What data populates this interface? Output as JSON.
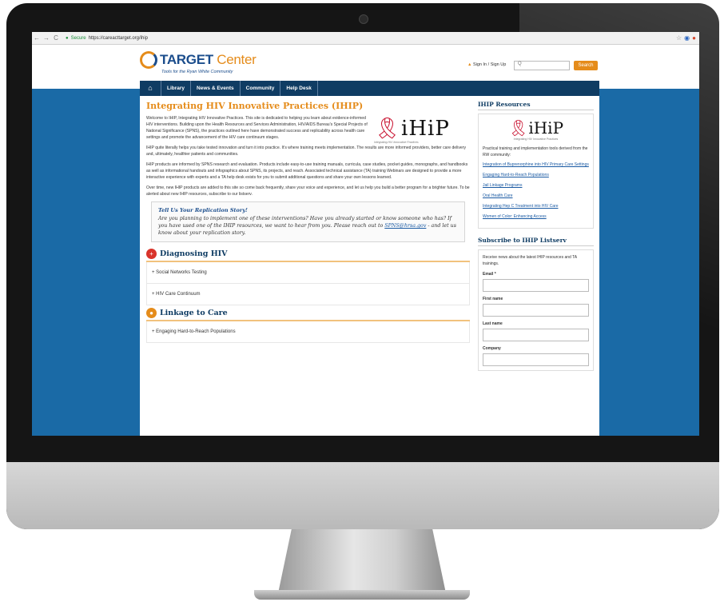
{
  "browser": {
    "secure_label": "Secure",
    "url": "https://careacttarget.org/ihip",
    "nav_icons": {
      "back": "back-arrow-icon",
      "forward": "forward-arrow-icon",
      "reload": "reload-icon"
    },
    "back": "←",
    "forward": "→",
    "reload": "C"
  },
  "header": {
    "logo_name": "TARGET",
    "logo_center": "Center",
    "tagline": "Tools for the Ryan White Community",
    "signin": "Sign In / Sign Up",
    "search_placeholder": "Q",
    "search_button": "Search"
  },
  "nav": {
    "items": [
      "Library",
      "News & Events",
      "Community",
      "Help Desk"
    ]
  },
  "main": {
    "title": "Integrating HIV Innovative Practices (IHIP)",
    "intro": "Welcome to IHIP, Integrating HIV Innovative Practices. This site is dedicated to helping you learn about evidence-informed HIV interventions. Building upon the Health Resources and Services Administration, HIV/AIDS Bureau's Special Projects of National Significance (SPNS), the practices outlined here have demonstrated success and replicability across health care settings and promote the advancement of the HIV care continuum stages.",
    "p2": "IHIP quite literally helps you take tested innovation and turn it into practice. It's where training meets implementation. The results are more informed providers, better care delivery and, ultimately, healthier patients and communities.",
    "p3": "IHIP products are informed by SPNS research and evaluation. Products include easy-to-use training manuals, curricula, case studies, pocket guides, monographs, and handbooks as well as informational handouts and infographics about SPNS, its projects, and reach. Associated technical assistance (TA) training Webinars are designed to provide a more interactive experience with experts and a TA help desk exists for you to submit additional questions and share your own lessons learned.",
    "p4": "Over time, new IHIP products are added to this site so come back frequently, share your voice and experience, and let us help you build a better program for a brighter future. To be alerted about new IHIP resources, subscribe to our listserv.",
    "logo_word": "iHiP",
    "logo_sub": "Integrating HIV Innovative Practices",
    "callout": {
      "title": "Tell Us Your Replication Story!",
      "body_before": "Are you planning to implement one of these interventions? Have you already started or know someone who has? If you have used one of the IHIP resources, we want to hear from you. Please reach out to ",
      "email": "SPNS@hrsa.gov",
      "body_after": " - and let us know about your replication story."
    },
    "sections": [
      {
        "title": "Diagnosing HIV",
        "icon": "+",
        "color": "#d9342b",
        "items": [
          "Social Networks Testing",
          "HIV Care Continuum"
        ]
      },
      {
        "title": "Linkage to Care",
        "icon": "●",
        "color": "#e58c1b",
        "items": [
          "Engaging Hard-to-Reach Populations"
        ]
      }
    ]
  },
  "sidebar": {
    "resources_title": "IHIP Resources",
    "logo_word": "iHiP",
    "logo_sub": "Integrating HIV Innovative Practices",
    "desc": "Practical training and implementation tools derived from the RW community:",
    "links": [
      "Integration of Buprenorphine into HIV Primary Care Settings",
      "Engaging Hard-to-Reach Populations",
      "Jail Linkage Programs",
      "Oral Health Care",
      "Integrating Hep C Treatment into HIV Care",
      "Women of Color: Enhancing Access"
    ],
    "subscribe_title": "Subscribe to IHIP Listserv",
    "subscribe_desc": "Receive news about the latest IHIP resources and TA trainings.",
    "fields": [
      "Email *",
      "First name",
      "Last name",
      "Company"
    ]
  },
  "colors": {
    "brand_blue": "#0f3c63",
    "accent_orange": "#e58c1b",
    "page_bg": "#1a6aa6"
  }
}
